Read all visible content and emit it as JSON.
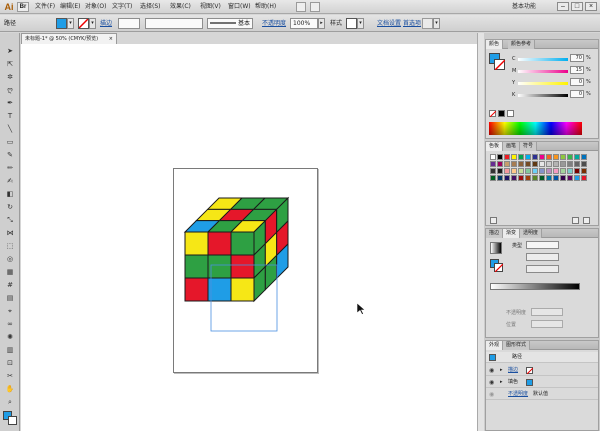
{
  "app": {
    "logo": "Ai",
    "bridge": "Br",
    "menu": [
      "文件(F)",
      "编辑(E)",
      "对象(O)",
      "文字(T)",
      "选择(S)",
      "效果(C)",
      "视图(V)",
      "窗口(W)",
      "帮助(H)"
    ],
    "workspace": "基本功能",
    "window_buttons": [
      "–",
      "□",
      "×"
    ]
  },
  "control_bar": {
    "selection_label": "路径",
    "fill_color": "#1f9de6",
    "stroke_label": "描边",
    "stroke_weight": "",
    "stroke_style_value": "基本",
    "opacity_label": "不透明度",
    "opacity_value": "100%",
    "style_label": "样式",
    "doc_setup_label": "文档设置",
    "prefs_label": "首选项"
  },
  "document": {
    "tab_title": "未标题-1* @ 50% (CMYK/预览)",
    "tab_close": "×"
  },
  "color_panel": {
    "tabs": [
      "颜色",
      "颜色参考"
    ],
    "sliders": [
      {
        "label": "C",
        "value": "70",
        "unit": "%",
        "gradient": [
          "#ffffff",
          "#00aeef"
        ]
      },
      {
        "label": "M",
        "value": "15",
        "unit": "%",
        "gradient": [
          "#ffffff",
          "#ec008c"
        ]
      },
      {
        "label": "Y",
        "value": "0",
        "unit": "%",
        "gradient": [
          "#ffffff",
          "#fff200"
        ]
      },
      {
        "label": "K",
        "value": "0",
        "unit": "%",
        "gradient": [
          "#ffffff",
          "#000000"
        ]
      }
    ]
  },
  "swatches_panel": {
    "tabs": [
      "色板",
      "画笔",
      "符号"
    ]
  },
  "gradient_panel": {
    "tabs": [
      "描边",
      "渐变",
      "透明度"
    ],
    "type_label": "类型",
    "angle_label": "",
    "ratio_label": "",
    "opacity_label": "不透明度",
    "position_label": "位置"
  },
  "appearance_panel": {
    "tabs": [
      "外观",
      "图形样式"
    ],
    "object_title": "路径",
    "rows": [
      {
        "label": "描边",
        "swatch": "#ffffff"
      },
      {
        "label": "填色",
        "swatch": "#1f9de6"
      },
      {
        "label": "不透明度",
        "value": "默认值"
      }
    ]
  },
  "cube_colors": {
    "red": "#e5172a",
    "green": "#2ea043",
    "blue": "#1f9de6",
    "yellow": "#f6e716",
    "front": [
      "yellow",
      "red",
      "green",
      "green",
      "green",
      "red",
      "red",
      "blue",
      "yellow"
    ],
    "top": [
      "yellow",
      "green",
      "green",
      "yellow",
      "red",
      "green",
      "blue",
      "green",
      "yellow"
    ],
    "right": [
      "green",
      "red",
      "green",
      "green",
      "yellow",
      "red",
      "green",
      "green",
      "blue"
    ]
  }
}
